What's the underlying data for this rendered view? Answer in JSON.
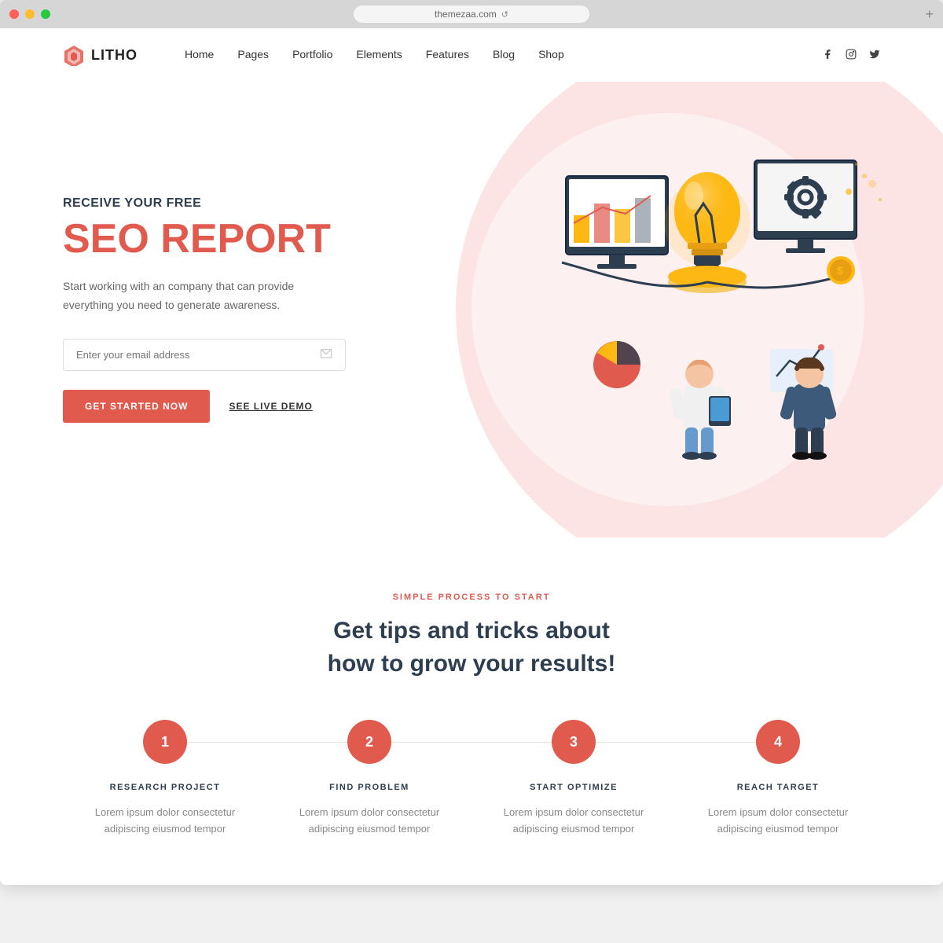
{
  "browser": {
    "url": "themezaa.com",
    "reload_label": "↺"
  },
  "navbar": {
    "logo_text": "LITHO",
    "links": [
      {
        "label": "Home",
        "href": "#"
      },
      {
        "label": "Pages",
        "href": "#"
      },
      {
        "label": "Portfolio",
        "href": "#"
      },
      {
        "label": "Elements",
        "href": "#"
      },
      {
        "label": "Features",
        "href": "#"
      },
      {
        "label": "Blog",
        "href": "#"
      },
      {
        "label": "Shop",
        "href": "#"
      }
    ],
    "social": [
      {
        "name": "facebook",
        "icon": "f"
      },
      {
        "name": "instagram",
        "icon": "◎"
      },
      {
        "name": "twitter",
        "icon": "𝕥"
      }
    ]
  },
  "hero": {
    "subtitle": "RECEIVE YOUR FREE",
    "title": "SEO REPORT",
    "description": "Start working with an company that can provide everything you need to generate awareness.",
    "email_placeholder": "Enter your email address",
    "btn_primary": "GET STARTED NOW",
    "btn_secondary": "SEE LIVE DEMO"
  },
  "process": {
    "tag": "SIMPLE PROCESS TO START",
    "title": "Get tips and tricks about\nhow to grow your results!",
    "steps": [
      {
        "number": "1",
        "title": "RESEARCH PROJECT",
        "desc": "Lorem ipsum dolor consectetur adipiscing eiusmod tempor"
      },
      {
        "number": "2",
        "title": "FIND PROBLEM",
        "desc": "Lorem ipsum dolor consectetur adipiscing eiusmod tempor"
      },
      {
        "number": "3",
        "title": "START OPTIMIZE",
        "desc": "Lorem ipsum dolor consectetur adipiscing eiusmod tempor"
      },
      {
        "number": "4",
        "title": "REACH TARGET",
        "desc": "Lorem ipsum dolor consectetur adipiscing eiusmod tempor"
      }
    ]
  },
  "colors": {
    "primary": "#e05a4e",
    "dark": "#2d3e50",
    "light_pink": "#fce4e4"
  }
}
